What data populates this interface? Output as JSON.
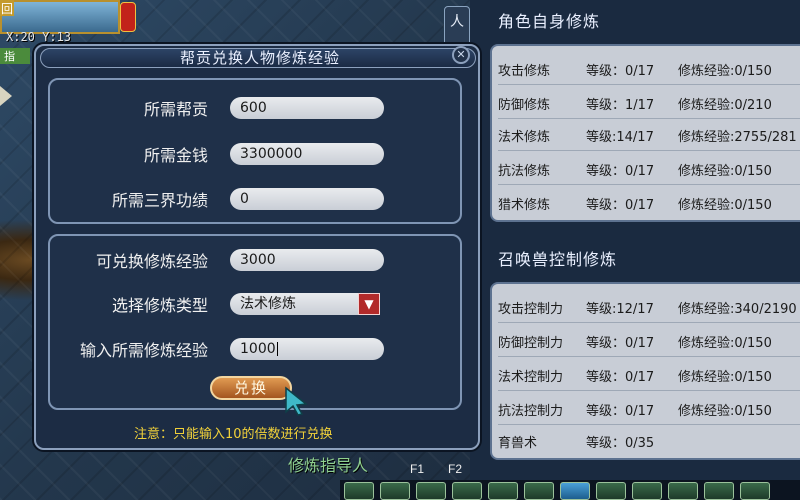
{
  "hud": {
    "map_label": "回",
    "coords": "X:20  Y:13",
    "cut_tab": "指",
    "side_tab": "人"
  },
  "dialog": {
    "title": "帮贡兑换人物修炼经验",
    "close_icon": "close-icon",
    "costs": {
      "gang_contribution_label": "所需帮贡",
      "gang_contribution_value": "600",
      "money_label": "所需金钱",
      "money_value": "3300000",
      "merit_label": "所需三界功绩",
      "merit_value": "0"
    },
    "exchange": {
      "available_label": "可兑换修炼经验",
      "available_value": "3000",
      "type_label": "选择修炼类型",
      "type_value": "法术修炼",
      "input_label": "输入所需修炼经验",
      "input_value": "1000",
      "button_label": "兑换"
    },
    "notice": "注意：只能输入10的倍数进行兑换"
  },
  "right_panel": {
    "self_header": "角色自身修炼",
    "self_rows": [
      {
        "name": "攻击修炼",
        "level": "等级：0/17",
        "exp": "修炼经验:0/150"
      },
      {
        "name": "防御修炼",
        "level": "等级：1/17",
        "exp": "修炼经验:0/210"
      },
      {
        "name": "法术修炼",
        "level": "等级:14/17",
        "exp": "修炼经验:2755/281"
      },
      {
        "name": "抗法修炼",
        "level": "等级：0/17",
        "exp": "修炼经验:0/150"
      },
      {
        "name": "猎术修炼",
        "level": "等级：0/17",
        "exp": "修炼经验:0/150"
      }
    ],
    "pet_header": "召唤兽控制修炼",
    "pet_rows": [
      {
        "name": "攻击控制力",
        "level": "等级:12/17",
        "exp": "修炼经验:340/2190"
      },
      {
        "name": "防御控制力",
        "level": "等级：0/17",
        "exp": "修炼经验:0/150"
      },
      {
        "name": "法术控制力",
        "level": "等级：0/17",
        "exp": "修炼经验:0/150"
      },
      {
        "name": "抗法控制力",
        "level": "等级：0/17",
        "exp": "修炼经验:0/150"
      },
      {
        "name": "育兽术",
        "level": "等级：0/35",
        "exp": ""
      }
    ]
  },
  "bottom": {
    "guide_label": "修炼指导人",
    "f1": "F1",
    "f2": "F2"
  },
  "colors": {
    "notice": "#f2d23a",
    "button": "#c2732f",
    "dropdown": "#b22a2a",
    "panel_bg": "#1c2c44"
  }
}
